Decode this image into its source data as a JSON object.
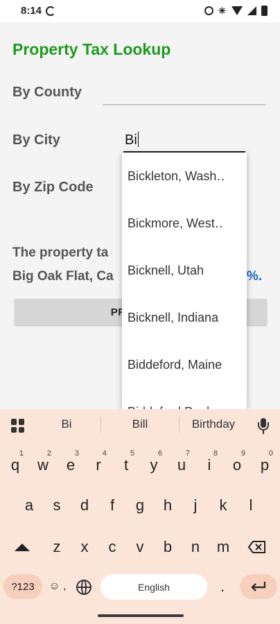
{
  "status_bar": {
    "time": "8:14"
  },
  "app": {
    "title": "Property Tax Lookup",
    "by_county_label": "By County",
    "by_city_label": "By City",
    "by_zip_label": "By Zip Code",
    "county_value": "",
    "city_value": "Bi",
    "result_line1": "The property ta",
    "result_line2": "Big Oak Flat, Ca",
    "result_rate": "%.",
    "button_label": "PROPERTY"
  },
  "dropdown": {
    "items": [
      "Bickleton, Wash‥",
      "Bickmore, West‥",
      "Bicknell, Utah",
      "Bicknell, Indiana",
      "Biddeford, Maine",
      "Biddeford Pool"
    ]
  },
  "keyboard": {
    "suggestions": [
      "Bi",
      "Bill",
      "Birthday"
    ],
    "row1": [
      "q",
      "w",
      "e",
      "r",
      "t",
      "y",
      "u",
      "i",
      "o",
      "p"
    ],
    "row1_hints": [
      "1",
      "2",
      "3",
      "4",
      "5",
      "6",
      "7",
      "8",
      "9",
      "0"
    ],
    "row2": [
      "a",
      "s",
      "d",
      "f",
      "g",
      "h",
      "j",
      "k",
      "l"
    ],
    "row3": [
      "z",
      "x",
      "c",
      "v",
      "b",
      "n",
      "m"
    ],
    "symbols_label": "?123",
    "emoji_label": "☺ ,",
    "space_label": "English",
    "period_label": "."
  },
  "colors": {
    "title_green": "#1e9a1e",
    "rate_blue": "#1565c0",
    "keyboard_bg": "#fbe5d9",
    "keyboard_accent_key": "#f7cfbd"
  },
  "icons": {
    "status": [
      "sync-icon",
      "alarm-icon",
      "bluetooth-icon",
      "wifi-icon",
      "signal-icon",
      "battery-icon"
    ],
    "keyboard": [
      "apps-grid-icon",
      "mic-icon",
      "shift-icon",
      "backspace-icon",
      "globe-icon",
      "enter-icon"
    ]
  }
}
